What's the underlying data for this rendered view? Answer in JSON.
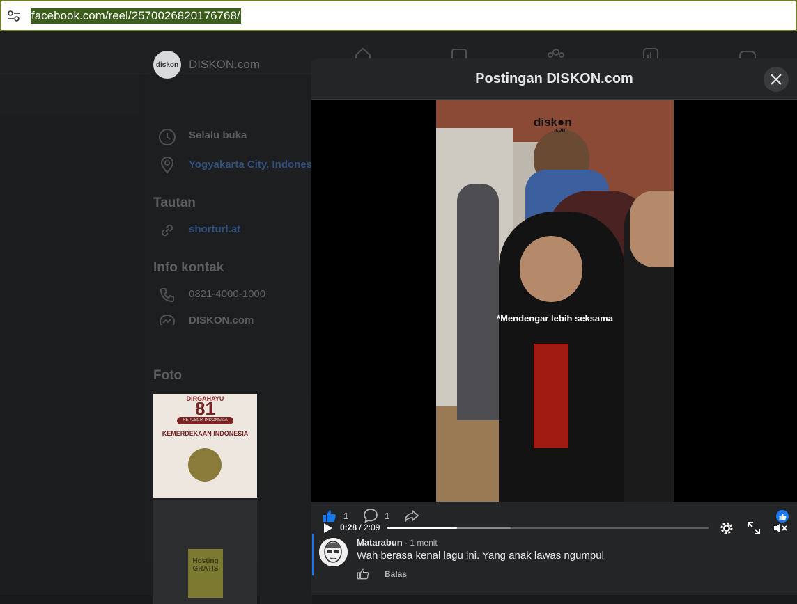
{
  "browser": {
    "url": "facebook.com/reel/2570026820176768/"
  },
  "page": {
    "name": "DISKON.com",
    "avatar_text": "diskon",
    "hours": "Selalu buka",
    "location": "Yogyakarta City, Indonesia",
    "links_heading": "Tautan",
    "link": "shorturl.at",
    "contact_heading": "Info kontak",
    "phone": "0821-4000-1000",
    "messenger": "DISKON.com",
    "photos_heading": "Foto",
    "thumb1_text": "81",
    "thumb1_sub": "REPUBLIK INDONESIA",
    "thumb1_title": "KEMERDEKAAN INDONESIA",
    "thumb1_top": "DIRGAHAYU",
    "thumb3_text": "Hosting GRATIS"
  },
  "modal": {
    "title": "Postingan DISKON.com",
    "video": {
      "watermark": "disk●n",
      "watermark_sub": ".com",
      "caption": "*Mendengar lebih seksama",
      "current_time": "0:28",
      "separator": " / ",
      "duration": "2:09",
      "progress_fraction": 0.217,
      "buffer_fraction": 0.385
    },
    "actions": {
      "like_count": "1",
      "comment_count": "1"
    },
    "comment": {
      "author": "Matarabun",
      "time": " · 1 menit",
      "text": "Wah berasa kenal lagu ini. Yang anak lawas ngumpul",
      "reply_label": "Balas"
    }
  },
  "colors": {
    "accent": "#1877f2",
    "url_highlight": "#3b5e1c"
  }
}
